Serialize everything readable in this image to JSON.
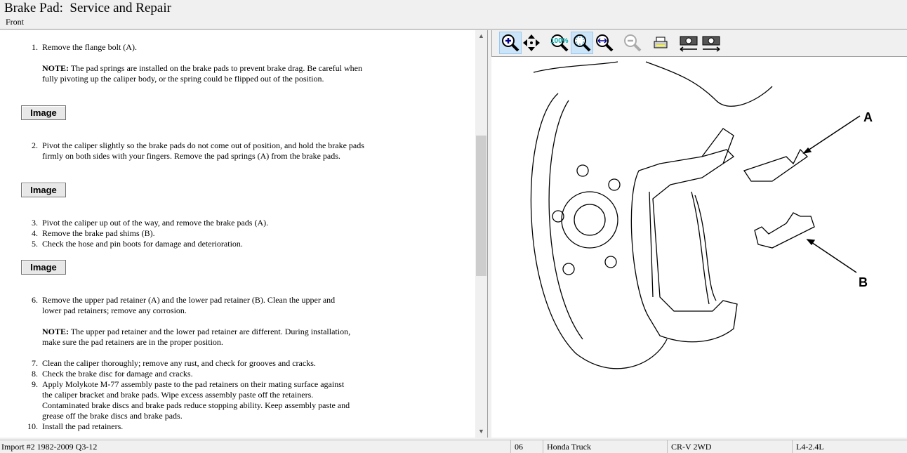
{
  "header": {
    "title": "Brake Pad:  Service and Repair",
    "subtitle": "Front"
  },
  "steps": [
    {
      "num": "1.",
      "text": "Remove the flange bolt (A)."
    },
    {
      "note_label": "NOTE:",
      "note": " The pad springs are installed on the brake pads to prevent brake drag. Be careful when fully pivoting up the caliper body, or the spring could be flipped out of the position."
    },
    {
      "num": "2.",
      "text": "Pivot the caliper slightly so the brake pads do not come out of position, and hold the brake pads firmly on both sides with your fingers. Remove the pad springs (A) from the brake pads."
    },
    {
      "num": "3.",
      "text": "Pivot the caliper up out of the way, and remove the brake pads (A)."
    },
    {
      "num": "4.",
      "text": "Remove the brake pad shims (B)."
    },
    {
      "num": "5.",
      "text": "Check the hose and pin boots for damage and deterioration."
    },
    {
      "num": "6.",
      "text": "Remove the upper pad retainer (A) and the lower pad retainer (B). Clean the upper and lower pad retainers; remove any corrosion."
    },
    {
      "note_label": "NOTE:",
      "note": " The upper pad retainer and the lower pad retainer are different. During installation, make sure the pad retainers are in the proper position."
    },
    {
      "num": "7.",
      "text": "Clean the caliper thoroughly; remove any rust, and check for grooves and cracks."
    },
    {
      "num": "8.",
      "text": "Check the brake disc for damage and cracks."
    },
    {
      "num": "9.",
      "text": "Apply Molykote M-77 assembly paste to the pad retainers on their mating surface against the caliper bracket and brake pads. Wipe excess assembly paste off the retainers. Contaminated brake discs and brake pads reduce stopping ability. Keep assembly paste and grease off the brake discs and brake pads."
    },
    {
      "num": "10.",
      "text": "Install the pad retainers."
    }
  ],
  "image_button": "Image",
  "toolbar": [
    "zoom-in",
    "pan",
    "zoom-100",
    "zoom-fit",
    "zoom-width",
    "zoom-out",
    "print",
    "previous-image",
    "next-image"
  ],
  "diagram": {
    "label_a": "A",
    "label_b": "B"
  },
  "status": {
    "source": "Import #2 1982-2009 Q3-12",
    "code": "06",
    "make": "Honda Truck",
    "model": "CR-V 2WD",
    "engine": "L4-2.4L"
  }
}
